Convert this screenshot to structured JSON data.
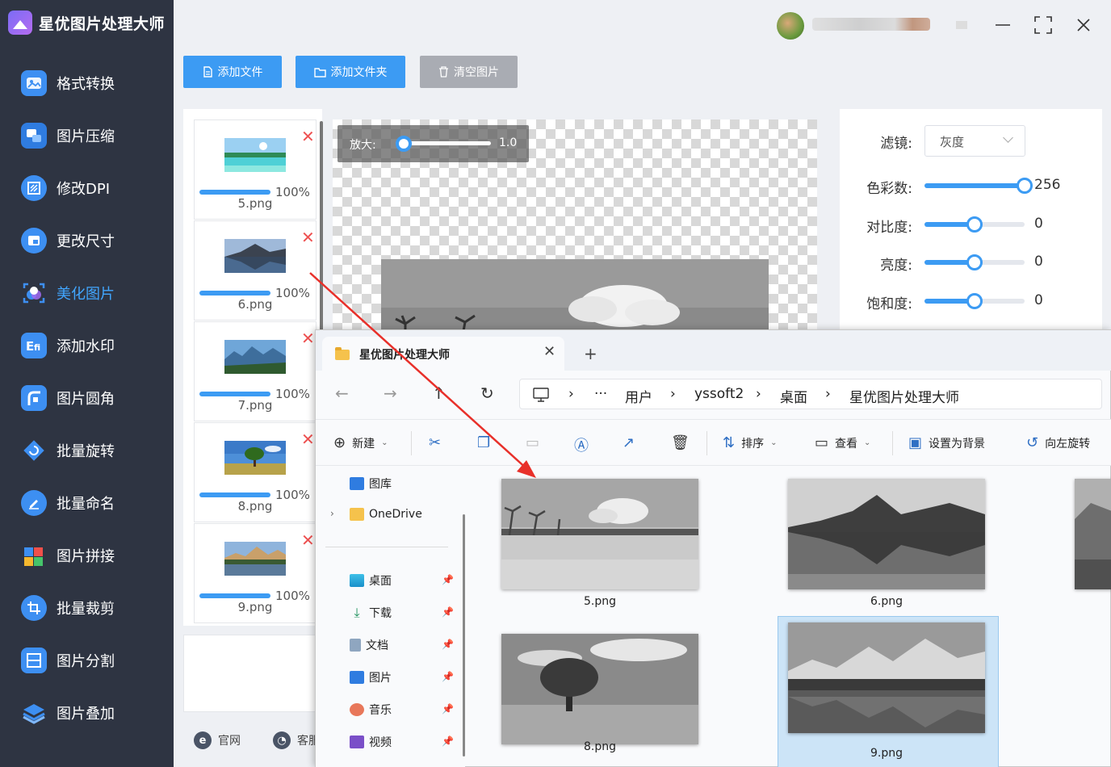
{
  "app": {
    "title": "星优图片处理大师"
  },
  "sidebar": {
    "items": [
      {
        "label": "格式转换",
        "icon": "image-convert-icon",
        "color": "#3d8ff2",
        "active": false
      },
      {
        "label": "图片压缩",
        "icon": "image-compress-icon",
        "color": "#3d8ff2",
        "active": false
      },
      {
        "label": "修改DPI",
        "icon": "dpi-icon",
        "color": "#3d8ff2",
        "active": false
      },
      {
        "label": "更改尺寸",
        "icon": "resize-icon",
        "color": "#3d8ff2",
        "active": false
      },
      {
        "label": "美化图片",
        "icon": "beautify-icon",
        "color": "#3d8ff2",
        "active": true
      },
      {
        "label": "添加水印",
        "icon": "watermark-icon",
        "color": "#3d8ff2",
        "active": false
      },
      {
        "label": "图片圆角",
        "icon": "round-corner-icon",
        "color": "#3d8ff2",
        "active": false
      },
      {
        "label": "批量旋转",
        "icon": "rotate-icon",
        "color": "#3d8ff2",
        "active": false
      },
      {
        "label": "批量命名",
        "icon": "rename-icon",
        "color": "#3d8ff2",
        "active": false
      },
      {
        "label": "图片拼接",
        "icon": "puzzle-icon",
        "color": "#3d8ff2",
        "active": false
      },
      {
        "label": "批量裁剪",
        "icon": "crop-icon",
        "color": "#3d8ff2",
        "active": false
      },
      {
        "label": "图片分割",
        "icon": "split-icon",
        "color": "#3d8ff2",
        "active": false
      },
      {
        "label": "图片叠加",
        "icon": "layers-icon",
        "color": "#3d8ff2",
        "active": false
      }
    ]
  },
  "toolbar": {
    "add_file": "添加文件",
    "add_folder": "添加文件夹",
    "clear": "清空图片"
  },
  "files": [
    {
      "name": "5.png",
      "progress": "100%"
    },
    {
      "name": "6.png",
      "progress": "100%"
    },
    {
      "name": "7.png",
      "progress": "100%"
    },
    {
      "name": "8.png",
      "progress": "100%"
    },
    {
      "name": "9.png",
      "progress": "100%"
    }
  ],
  "footer": {
    "website": "官网",
    "service": "客服"
  },
  "preview": {
    "zoom_label": "放大:",
    "zoom_value": "1.0",
    "zoom_fraction": 0.05
  },
  "settings": {
    "filter_label": "滤镜:",
    "filter_value": "灰度",
    "colors_label": "色彩数:",
    "colors_value": "256",
    "colors_fraction": 1.0,
    "contrast_label": "对比度:",
    "contrast_value": "0",
    "contrast_fraction": 0.5,
    "brightness_label": "亮度:",
    "brightness_value": "0",
    "brightness_fraction": 0.5,
    "saturation_label": "饱和度:",
    "saturation_value": "0",
    "saturation_fraction": 0.5
  },
  "explorer": {
    "tab_title": "星优图片处理大师",
    "path": [
      "用户",
      "yssoft2",
      "桌面",
      "星优图片处理大师"
    ],
    "commands": {
      "new": "新建",
      "sort": "排序",
      "view": "查看",
      "set_background": "设置为背景",
      "rotate_left": "向左旋转"
    },
    "sidebar": [
      {
        "label": "图库"
      },
      {
        "label": "OneDrive"
      },
      {
        "label": "桌面"
      },
      {
        "label": "下载"
      },
      {
        "label": "文档"
      },
      {
        "label": "图片"
      },
      {
        "label": "音乐"
      },
      {
        "label": "视频"
      }
    ],
    "items": [
      {
        "name": "5.png",
        "selected": false
      },
      {
        "name": "6.png",
        "selected": false
      },
      {
        "name": "8.png",
        "selected": false
      },
      {
        "name": "9.png",
        "selected": true
      }
    ]
  },
  "colors": {
    "accent": "#3c9bf3",
    "sidebar_bg": "#2e3442",
    "delete_red": "#ee5151",
    "arrow_red": "#e8302a"
  }
}
